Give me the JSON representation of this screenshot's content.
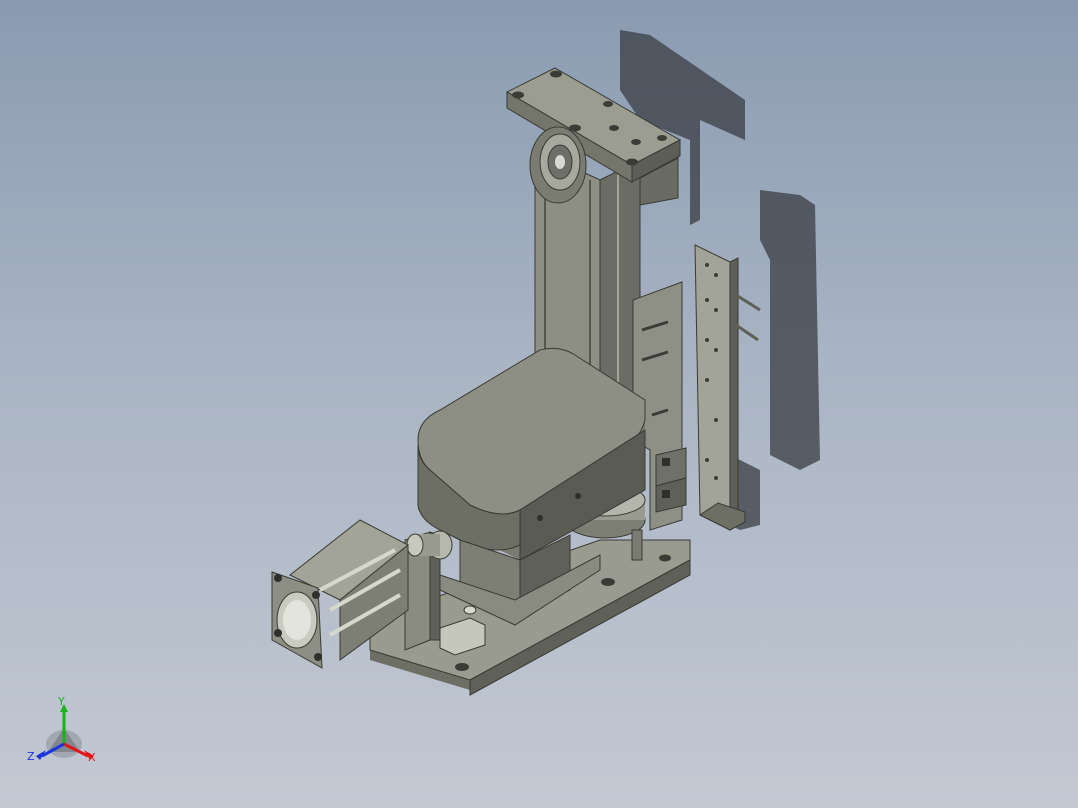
{
  "viewport": {
    "background_top": "#8a9bb1",
    "background_bottom": "#c3c9d3"
  },
  "model": {
    "part_color": "#8b8c80",
    "shadow_color": "#35383f"
  },
  "triad": {
    "x_label": "X",
    "y_label": "Y",
    "z_label": "Z",
    "x_color": "#e01818",
    "y_color": "#18b418",
    "z_color": "#1c34e0"
  }
}
